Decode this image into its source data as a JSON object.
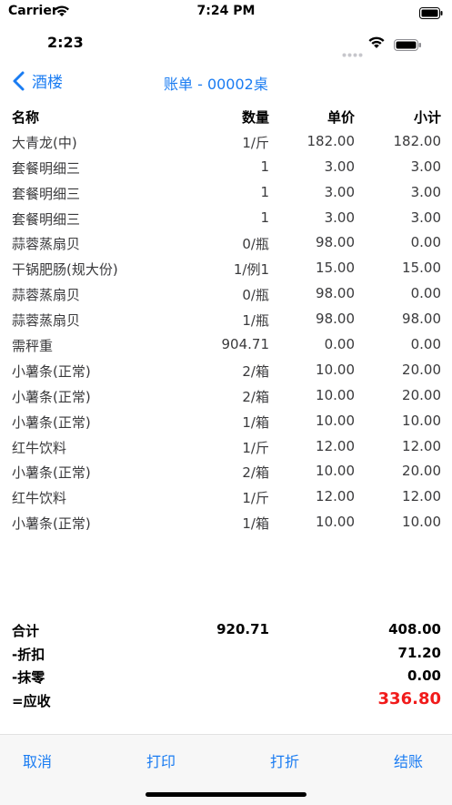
{
  "status_outer": {
    "carrier": "Carrier",
    "time": "7:24 PM"
  },
  "status_inner": {
    "time": "2:23"
  },
  "nav": {
    "back_label": "酒楼",
    "title": "账单 - 00002桌"
  },
  "table": {
    "headers": {
      "name": "名称",
      "qty": "数量",
      "price": "单价",
      "subtotal": "小计"
    },
    "rows": [
      {
        "name": "大青龙(中)",
        "qty": "1/斤",
        "price": "182.00",
        "subtotal": "182.00"
      },
      {
        "name": "套餐明细三",
        "qty": "1",
        "price": "3.00",
        "subtotal": "3.00"
      },
      {
        "name": "套餐明细三",
        "qty": "1",
        "price": "3.00",
        "subtotal": "3.00"
      },
      {
        "name": "套餐明细三",
        "qty": "1",
        "price": "3.00",
        "subtotal": "3.00"
      },
      {
        "name": "蒜蓉蒸扇贝",
        "qty": "0/瓶",
        "price": "98.00",
        "subtotal": "0.00"
      },
      {
        "name": "干锅肥肠(规大份)",
        "qty": "1/例1",
        "price": "15.00",
        "subtotal": "15.00"
      },
      {
        "name": "蒜蓉蒸扇贝",
        "qty": "0/瓶",
        "price": "98.00",
        "subtotal": "0.00"
      },
      {
        "name": "蒜蓉蒸扇贝",
        "qty": "1/瓶",
        "price": "98.00",
        "subtotal": "98.00"
      },
      {
        "name": "需秤重",
        "qty": "904.71",
        "price": "0.00",
        "subtotal": "0.00"
      },
      {
        "name": "小薯条(正常)",
        "qty": "2/箱",
        "price": "10.00",
        "subtotal": "20.00"
      },
      {
        "name": "小薯条(正常)",
        "qty": "2/箱",
        "price": "10.00",
        "subtotal": "20.00"
      },
      {
        "name": "小薯条(正常)",
        "qty": "1/箱",
        "price": "10.00",
        "subtotal": "10.00"
      },
      {
        "name": "红牛饮料",
        "qty": "1/斤",
        "price": "12.00",
        "subtotal": "12.00"
      },
      {
        "name": "小薯条(正常)",
        "qty": "2/箱",
        "price": "10.00",
        "subtotal": "20.00"
      },
      {
        "name": "红牛饮料",
        "qty": "1/斤",
        "price": "12.00",
        "subtotal": "12.00"
      },
      {
        "name": "小薯条(正常)",
        "qty": "1/箱",
        "price": "10.00",
        "subtotal": "10.00"
      }
    ]
  },
  "totals": {
    "total_label": "合计",
    "total_qty": "920.71",
    "total_value": "408.00",
    "discount_label": "-折扣",
    "discount_value": "71.20",
    "rounding_label": "-抹零",
    "rounding_value": "0.00",
    "due_label": "=应收",
    "due_value": "336.80"
  },
  "actions": {
    "cancel": "取消",
    "print": "打印",
    "discount": "打折",
    "checkout": "结账"
  },
  "colors": {
    "accent": "#1a7cf2",
    "due": "#f11b1b"
  }
}
